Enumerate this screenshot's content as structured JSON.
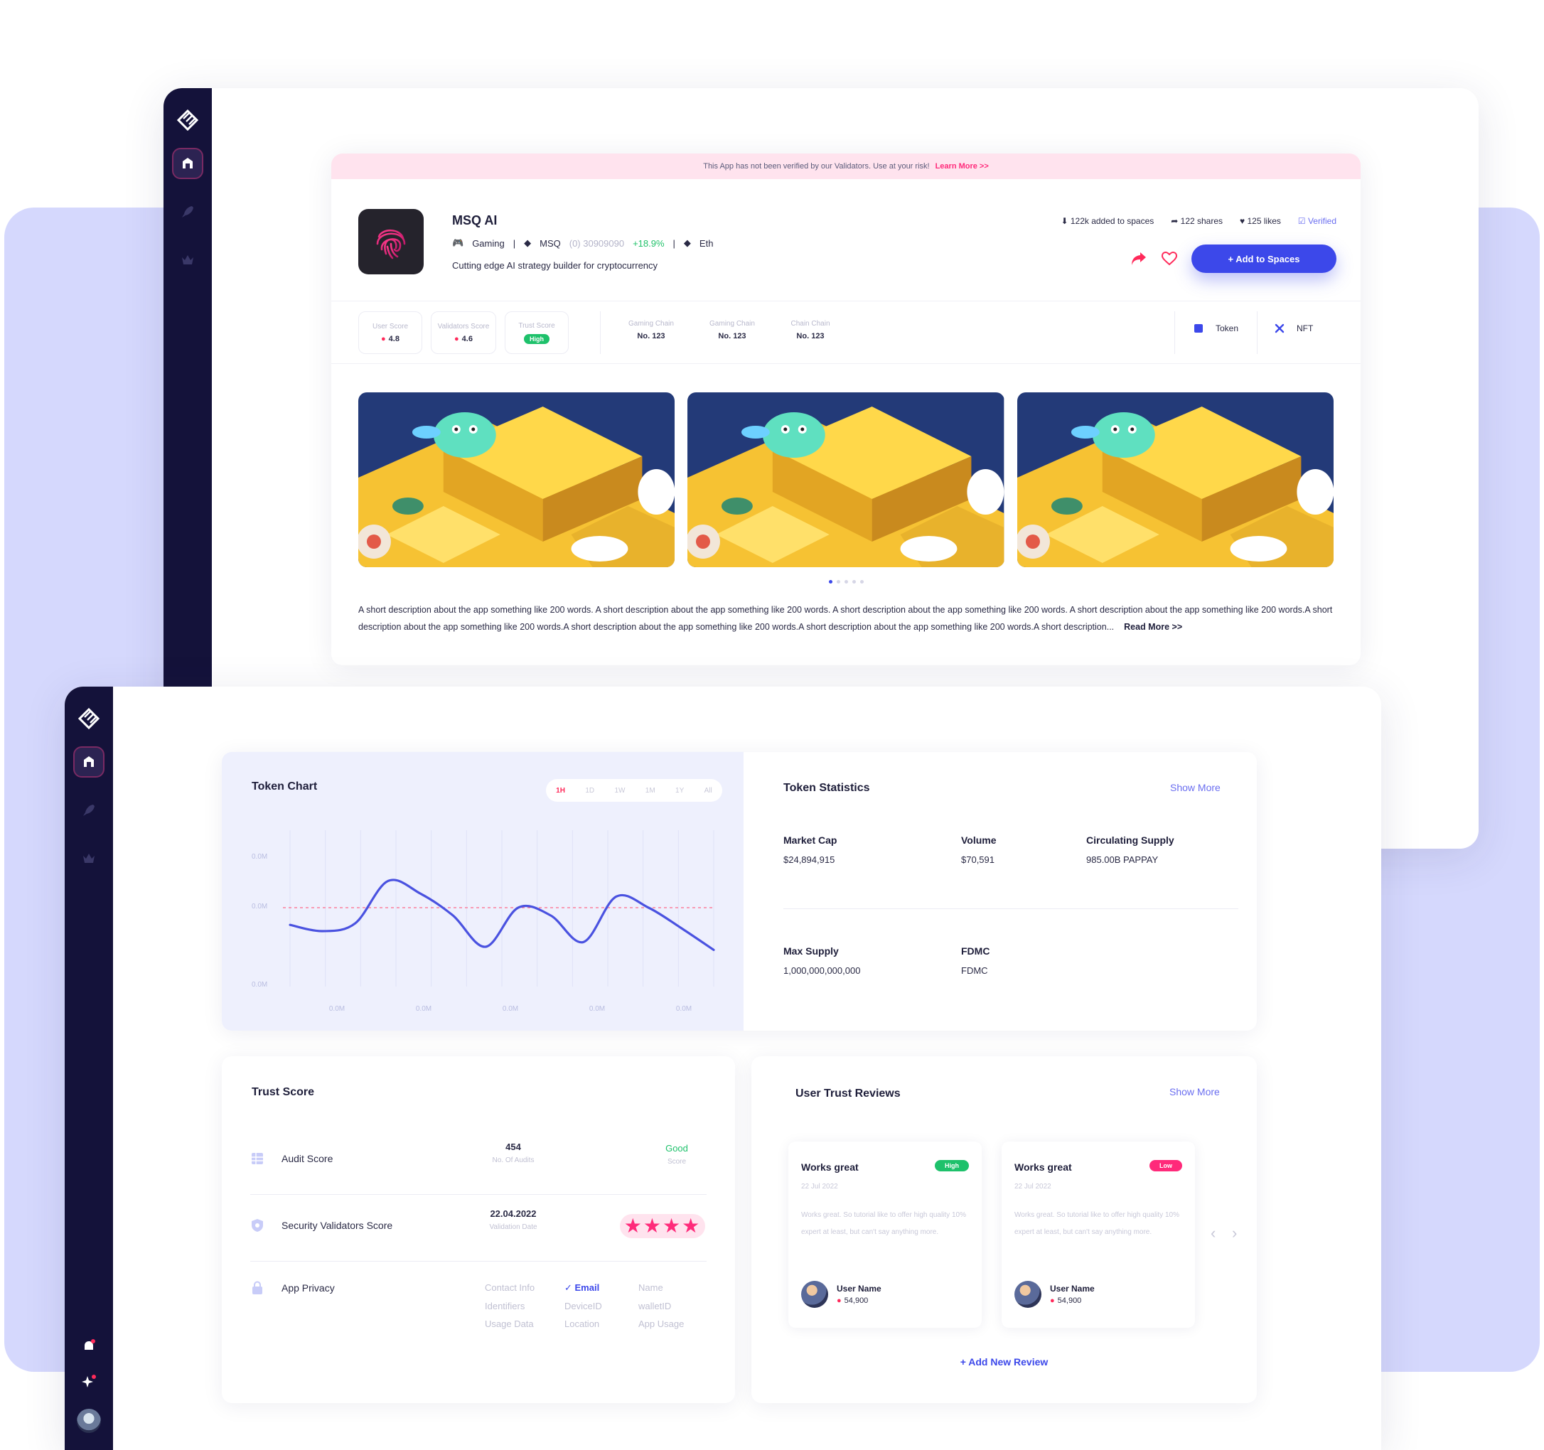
{
  "colors": {
    "accent": "#3c48ea",
    "sidebar": "#14123a",
    "backdrop": "#d5d8fd",
    "warning_bg": "#ffe3ee",
    "pink": "#ff2a5a",
    "green": "#1ec16b",
    "chart_line": "#4a52e0"
  },
  "app": {
    "warning_text": "This App has not been verified by our Validators. Use at your risk!",
    "warning_link": "Learn More >>",
    "name": "MSQ AI",
    "category": "Gaming",
    "token_symbol": "MSQ",
    "token_id": "(0) 30909090",
    "token_change": "+18.9%",
    "chain": "Eth",
    "tagline": "Cutting edge AI strategy builder for cryptocurrency",
    "stats": {
      "added": "122k added to spaces",
      "shares": "122 shares",
      "likes": "125 likes",
      "verified": "Verified"
    },
    "add_button": "+ Add to Spaces",
    "scores": [
      {
        "label": "User Score",
        "value": "4.8"
      },
      {
        "label": "Validators Score",
        "value": "4.6"
      },
      {
        "label": "Trust Score",
        "value": "High"
      }
    ],
    "chains": [
      {
        "label": "Gaming Chain",
        "value": "No. 123"
      },
      {
        "label": "Gaming Chain",
        "value": "No. 123"
      },
      {
        "label": "Chain Chain",
        "value": "No. 123"
      }
    ],
    "types": [
      {
        "label": "Token",
        "icon": "token-icon"
      },
      {
        "label": "NFT",
        "icon": "nft-icon"
      }
    ],
    "description": "A short description about the app something like 200 words. A short description about the app something like 200 words. A short description about the app something like 200 words. A short description about the app something like 200 words.A short description about the app something like 200 words.A short description about the app something like 200 words.A short description about the app something like 200 words.A short description...",
    "read_more": "Read More >>"
  },
  "token_chart": {
    "title": "Token Chart",
    "ranges": [
      "1H",
      "1D",
      "1W",
      "1M",
      "1Y",
      "All"
    ],
    "active_range": "1H"
  },
  "chart_data": {
    "type": "line",
    "title": "Token Chart",
    "y_tick_labels": [
      "0.0M",
      "0.0M",
      "0.0M"
    ],
    "x_tick_labels": [
      "0.0M",
      "0.0M",
      "0.0M",
      "0.0M",
      "0.0M",
      "0.0M"
    ],
    "x": [
      0,
      1,
      2,
      3,
      4,
      5,
      6,
      7,
      8,
      9,
      10,
      11,
      12,
      13
    ],
    "series": [
      {
        "values": [
          0.44,
          0.4,
          0.45,
          0.72,
          0.64,
          0.5,
          0.3,
          0.55,
          0.5,
          0.33,
          0.62,
          0.55,
          0.42,
          0.28
        ]
      }
    ],
    "reference_line": 0.55,
    "ylim": [
      0,
      1
    ],
    "grid": true,
    "legend": false
  },
  "token_stats": {
    "title": "Token Statistics",
    "show_more": "Show More",
    "items": [
      {
        "label": "Market Cap",
        "value": "$24,894,915"
      },
      {
        "label": "Volume",
        "value": "$70,591"
      },
      {
        "label": "Circulating Supply",
        "value": "985.00B PAPPAY"
      },
      {
        "label": "Max Supply",
        "value": "1,000,000,000,000"
      },
      {
        "label": "FDMC",
        "value": "FDMC"
      }
    ]
  },
  "trust": {
    "title": "Trust Score",
    "audit": {
      "label": "Audit Score",
      "value": "454",
      "sub": "No. Of Audits",
      "rating": "Good",
      "rating_sub": "Score"
    },
    "security": {
      "label": "Security Validators Score",
      "value": "22.04.2022",
      "sub": "Validation Date",
      "stars": "★★★★"
    },
    "privacy": {
      "label": "App Privacy",
      "items": [
        {
          "label": "Contact Info"
        },
        {
          "label": "✓ Email"
        },
        {
          "label": "Name"
        },
        {
          "label": "Identifiers"
        },
        {
          "label": "DeviceID"
        },
        {
          "label": "walletID"
        },
        {
          "label": "Usage Data"
        },
        {
          "label": "Location"
        },
        {
          "label": "App Usage"
        }
      ]
    }
  },
  "reviews": {
    "title": "User Trust Reviews",
    "show_more": "Show More",
    "items": [
      {
        "title": "Works great",
        "badge": "High",
        "date": "22 Jul 2022",
        "body": "Works great. So tutorial like to offer high quality 10% expert at least, but can't say anything more.",
        "user": "User Name",
        "score": "54,900"
      },
      {
        "title": "Works great",
        "badge": "Low",
        "date": "22 Jul 2022",
        "body": "Works great. So tutorial like to offer high quality 10% expert at least, but can't say anything more.",
        "user": "User Name",
        "score": "54,900"
      }
    ],
    "add_review": "+ Add New Review"
  }
}
